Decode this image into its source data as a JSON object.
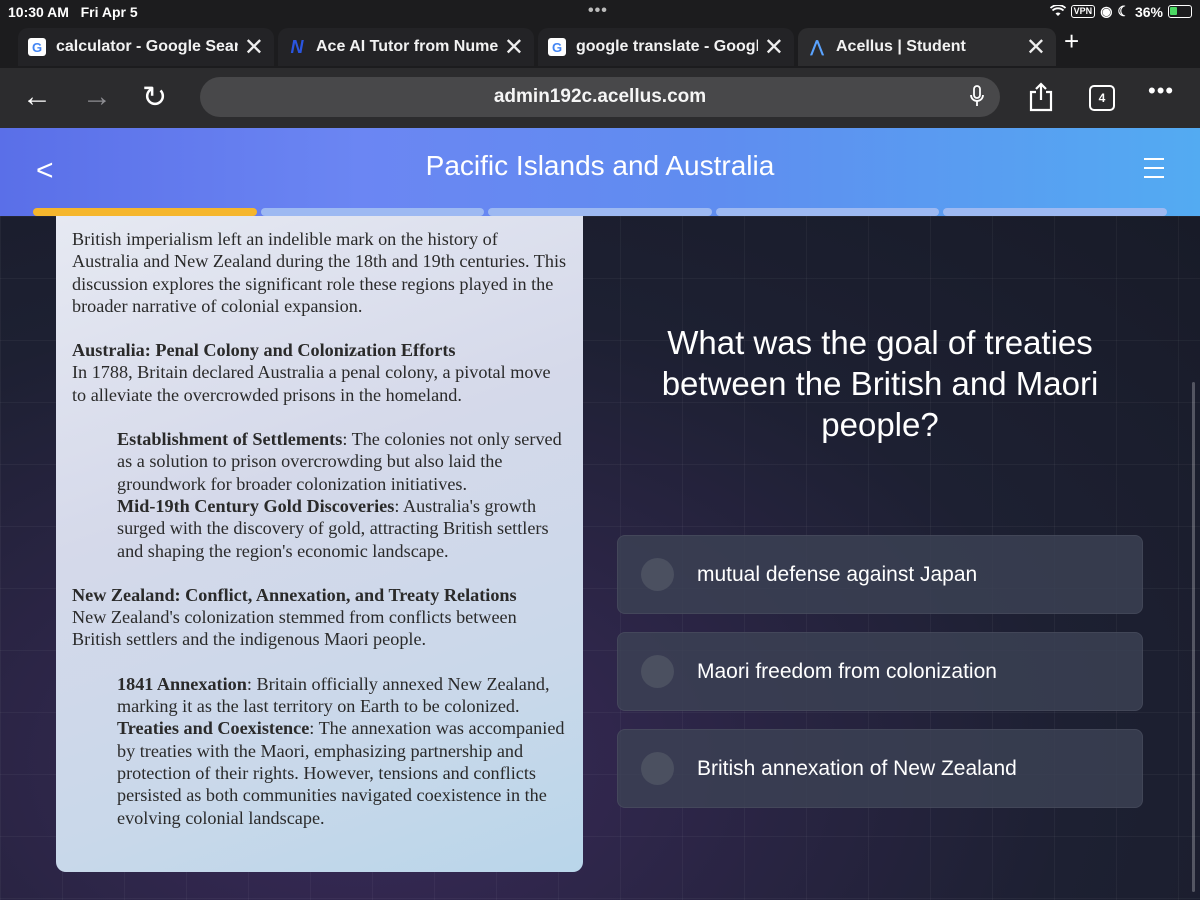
{
  "status": {
    "time": "10:30 AM",
    "date": "Fri Apr 5",
    "vpn": "VPN",
    "battery": "36%"
  },
  "tabs": [
    {
      "title": "calculator - Google Sear",
      "favicon": "google-icon"
    },
    {
      "title": "Ace AI Tutor from Nume",
      "favicon": "n-icon"
    },
    {
      "title": "google translate - Googl",
      "favicon": "google-icon"
    },
    {
      "title": "Acellus | Student",
      "favicon": "acellus-icon",
      "active": true
    }
  ],
  "toolbar": {
    "url": "admin192c.acellus.com",
    "tab_count": "4"
  },
  "lesson": {
    "title": "Pacific Islands and Australia",
    "progress_segments": 5,
    "progress_done": 1
  },
  "reading": {
    "intro": "British imperialism left an indelible mark on the history of Australia and New Zealand during the 18th and 19th centuries. This discussion explores the significant role these regions played in the broader narrative of colonial expansion.",
    "australia": {
      "heading": "Australia: Penal Colony and Colonization Efforts",
      "body": "In 1788, Britain declared Australia a penal colony, a pivotal move to alleviate the overcrowded prisons in the homeland.",
      "item1_head": "Establishment of Settlements",
      "item1_body": ": The colonies not only served as a solution to prison overcrowding but also laid the groundwork for broader colonization initiatives.",
      "item2_head": "Mid-19th Century Gold Discoveries",
      "item2_body": ": Australia's growth surged with the discovery of gold, attracting British settlers and shaping the region's economic landscape."
    },
    "nz": {
      "heading": "New Zealand: Conflict, Annexation, and Treaty Relations",
      "body": "New Zealand's colonization stemmed from conflicts between British settlers and the indigenous Maori people.",
      "item1_head": "1841 Annexation",
      "item1_body": ": Britain officially annexed New Zealand, marking it as the last territory on Earth to be colonized.",
      "item2_head": "Treaties and Coexistence",
      "item2_body": ": The annexation was accompanied by treaties with the Maori, emphasizing partnership and protection of their rights. However, tensions and conflicts persisted as both communities navigated coexistence in the evolving colonial landscape."
    }
  },
  "question": {
    "text": "What was the goal of treaties between the British and Maori people?",
    "answers": [
      "mutual defense against Japan",
      "Maori freedom from colonization",
      "British annexation of New Zealand"
    ]
  },
  "colors": {
    "progress_done": "#f5b62d",
    "header_start": "#5a6fe8",
    "header_end": "#53abf2"
  }
}
